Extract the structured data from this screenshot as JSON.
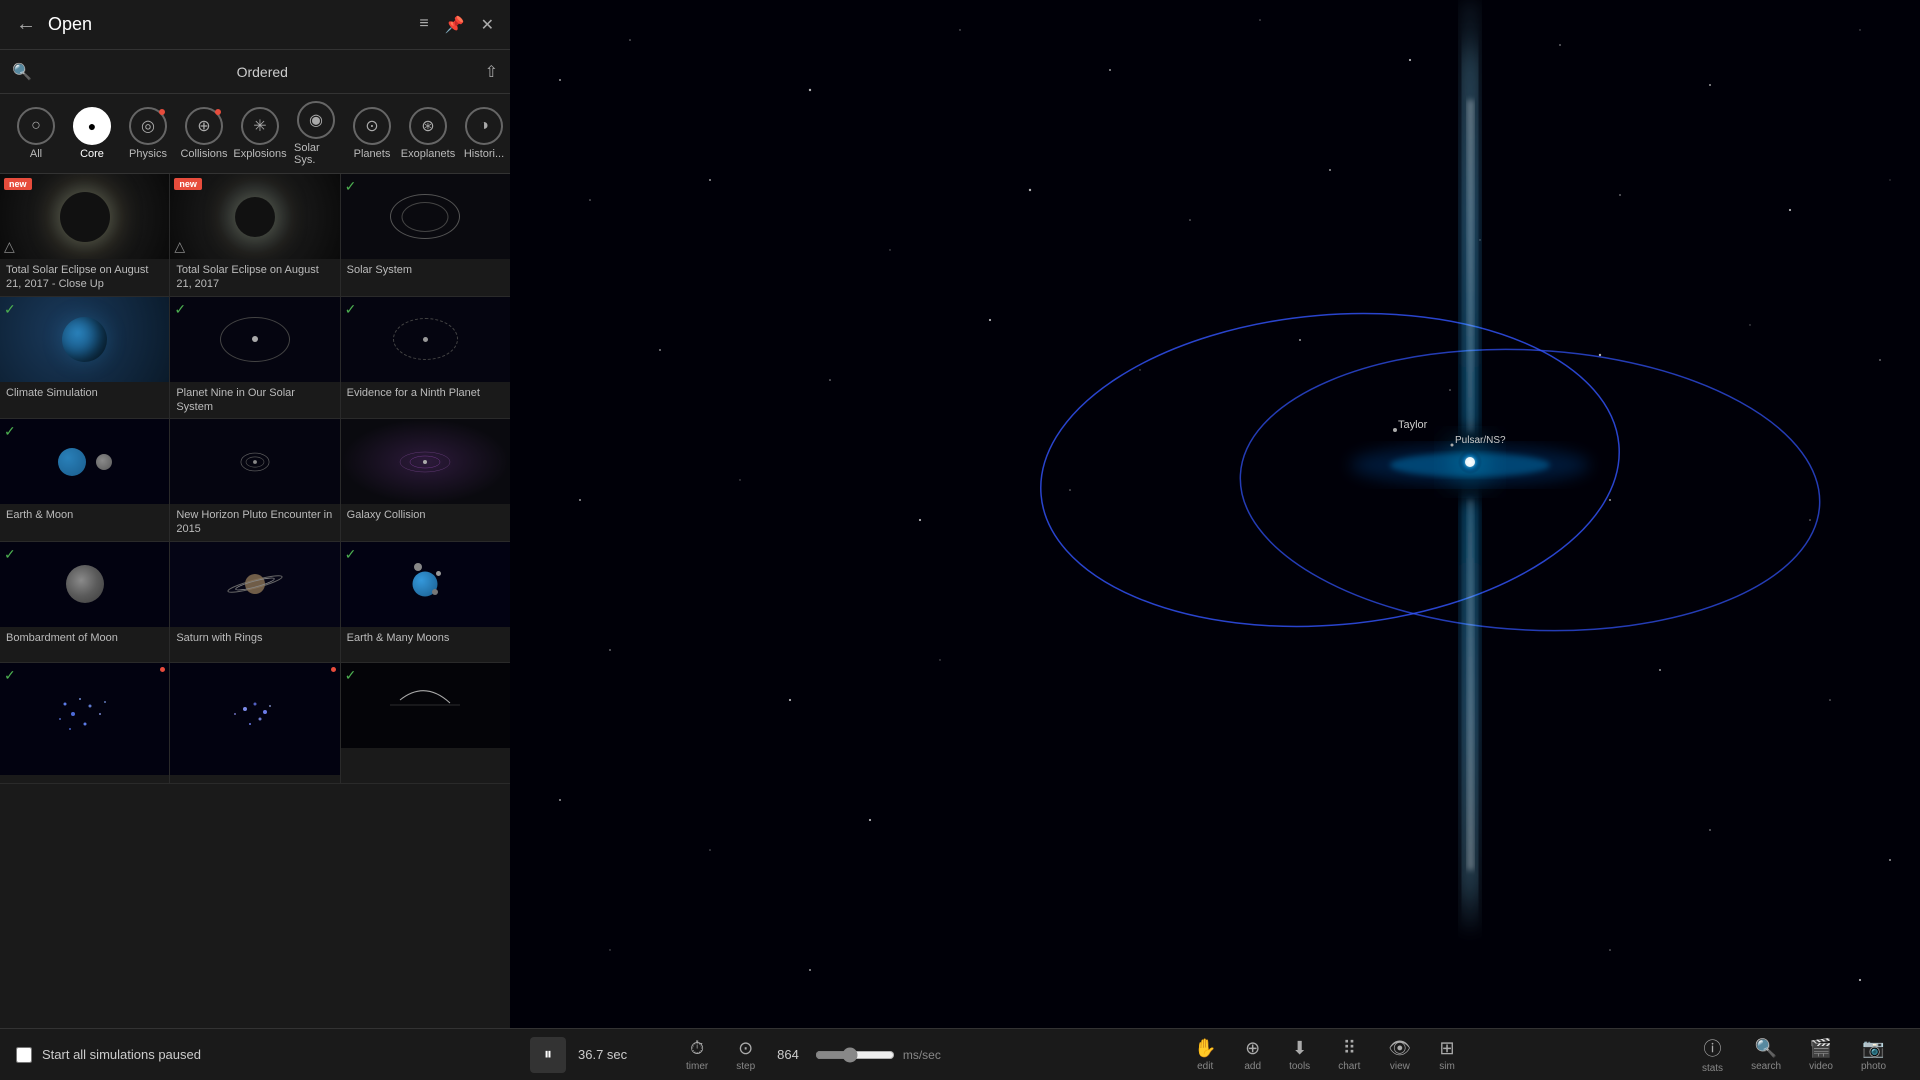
{
  "panel": {
    "title": "Open",
    "back_label": "←",
    "search_placeholder": "Search",
    "ordered_label": "Ordered",
    "sort_icon": "↑",
    "list_icon": "≡",
    "pin_icon": "⊞",
    "close_icon": "✕"
  },
  "categories": [
    {
      "id": "all",
      "label": "All",
      "icon": "○",
      "active": false,
      "dot": false
    },
    {
      "id": "core",
      "label": "Core",
      "icon": "●",
      "active": true,
      "dot": false
    },
    {
      "id": "physics",
      "label": "Physics",
      "icon": "◎",
      "active": false,
      "dot": true
    },
    {
      "id": "collisions",
      "label": "Collisions",
      "icon": "⊕",
      "active": false,
      "dot": true
    },
    {
      "id": "explosions",
      "label": "Explosions",
      "icon": "✳",
      "active": false,
      "dot": false
    },
    {
      "id": "solar-sys",
      "label": "Solar Sys.",
      "icon": "◉",
      "active": false,
      "dot": false
    },
    {
      "id": "planets",
      "label": "Planets",
      "icon": "⊙",
      "active": false,
      "dot": false
    },
    {
      "id": "exoplanets",
      "label": "Exoplanets",
      "icon": "⊛",
      "active": false,
      "dot": false
    },
    {
      "id": "histori",
      "label": "Histori...",
      "icon": "◑",
      "active": false,
      "dot": false
    }
  ],
  "grid_items": [
    {
      "label": "Total Solar Eclipse on August 21, 2017 - Close Up",
      "badge": "new",
      "check": false,
      "type": "eclipse"
    },
    {
      "label": "Total Solar Eclipse on August 21, 2017",
      "badge": "new",
      "check": false,
      "type": "eclipse2"
    },
    {
      "label": "Solar System",
      "badge": "",
      "check": true,
      "type": "solar"
    },
    {
      "label": "Climate Simulation",
      "badge": "",
      "check": true,
      "type": "climate"
    },
    {
      "label": "Planet Nine in Our Solar System",
      "badge": "",
      "check": true,
      "type": "planet9"
    },
    {
      "label": "Evidence for a Ninth Planet",
      "badge": "",
      "check": true,
      "type": "evidence"
    },
    {
      "label": "Earth & Moon",
      "badge": "",
      "check": true,
      "type": "earth-moon"
    },
    {
      "label": "New Horizon Pluto Encounter in 2015",
      "badge": "",
      "check": false,
      "type": "new-horizon"
    },
    {
      "label": "Galaxy Collision",
      "badge": "",
      "check": false,
      "type": "galaxy"
    },
    {
      "label": "Bombardment of Moon",
      "badge": "",
      "check": true,
      "type": "moon-bomb"
    },
    {
      "label": "Saturn with Rings",
      "badge": "",
      "check": false,
      "type": "saturn"
    },
    {
      "label": "Earth & Many Moons",
      "badge": "",
      "check": true,
      "type": "earth-moons"
    },
    {
      "label": "",
      "badge": "",
      "check": true,
      "type": "cluster1"
    },
    {
      "label": "",
      "badge": "",
      "check": false,
      "type": "cluster2"
    },
    {
      "label": "",
      "badge": "",
      "check": true,
      "type": "cluster3"
    }
  ],
  "bottom_checkbox": {
    "label": "Start all simulations paused",
    "checked": false
  },
  "toolbar": {
    "play_icon": "⏸",
    "time": "36.7 sec",
    "timer_label": "timer",
    "step_label": "step",
    "speed_value": "864",
    "speed_unit": "ms/sec",
    "edit_label": "edit",
    "add_label": "add",
    "tools_label": "tools",
    "chart_label": "chart",
    "view_label": "view",
    "sim_label": "sim",
    "stats_label": "stats",
    "search_label": "search",
    "video_label": "video",
    "photo_label": "photo"
  },
  "visualization": {
    "star_label1": "Taylor",
    "star_label2": "Pulsar/NS?"
  }
}
